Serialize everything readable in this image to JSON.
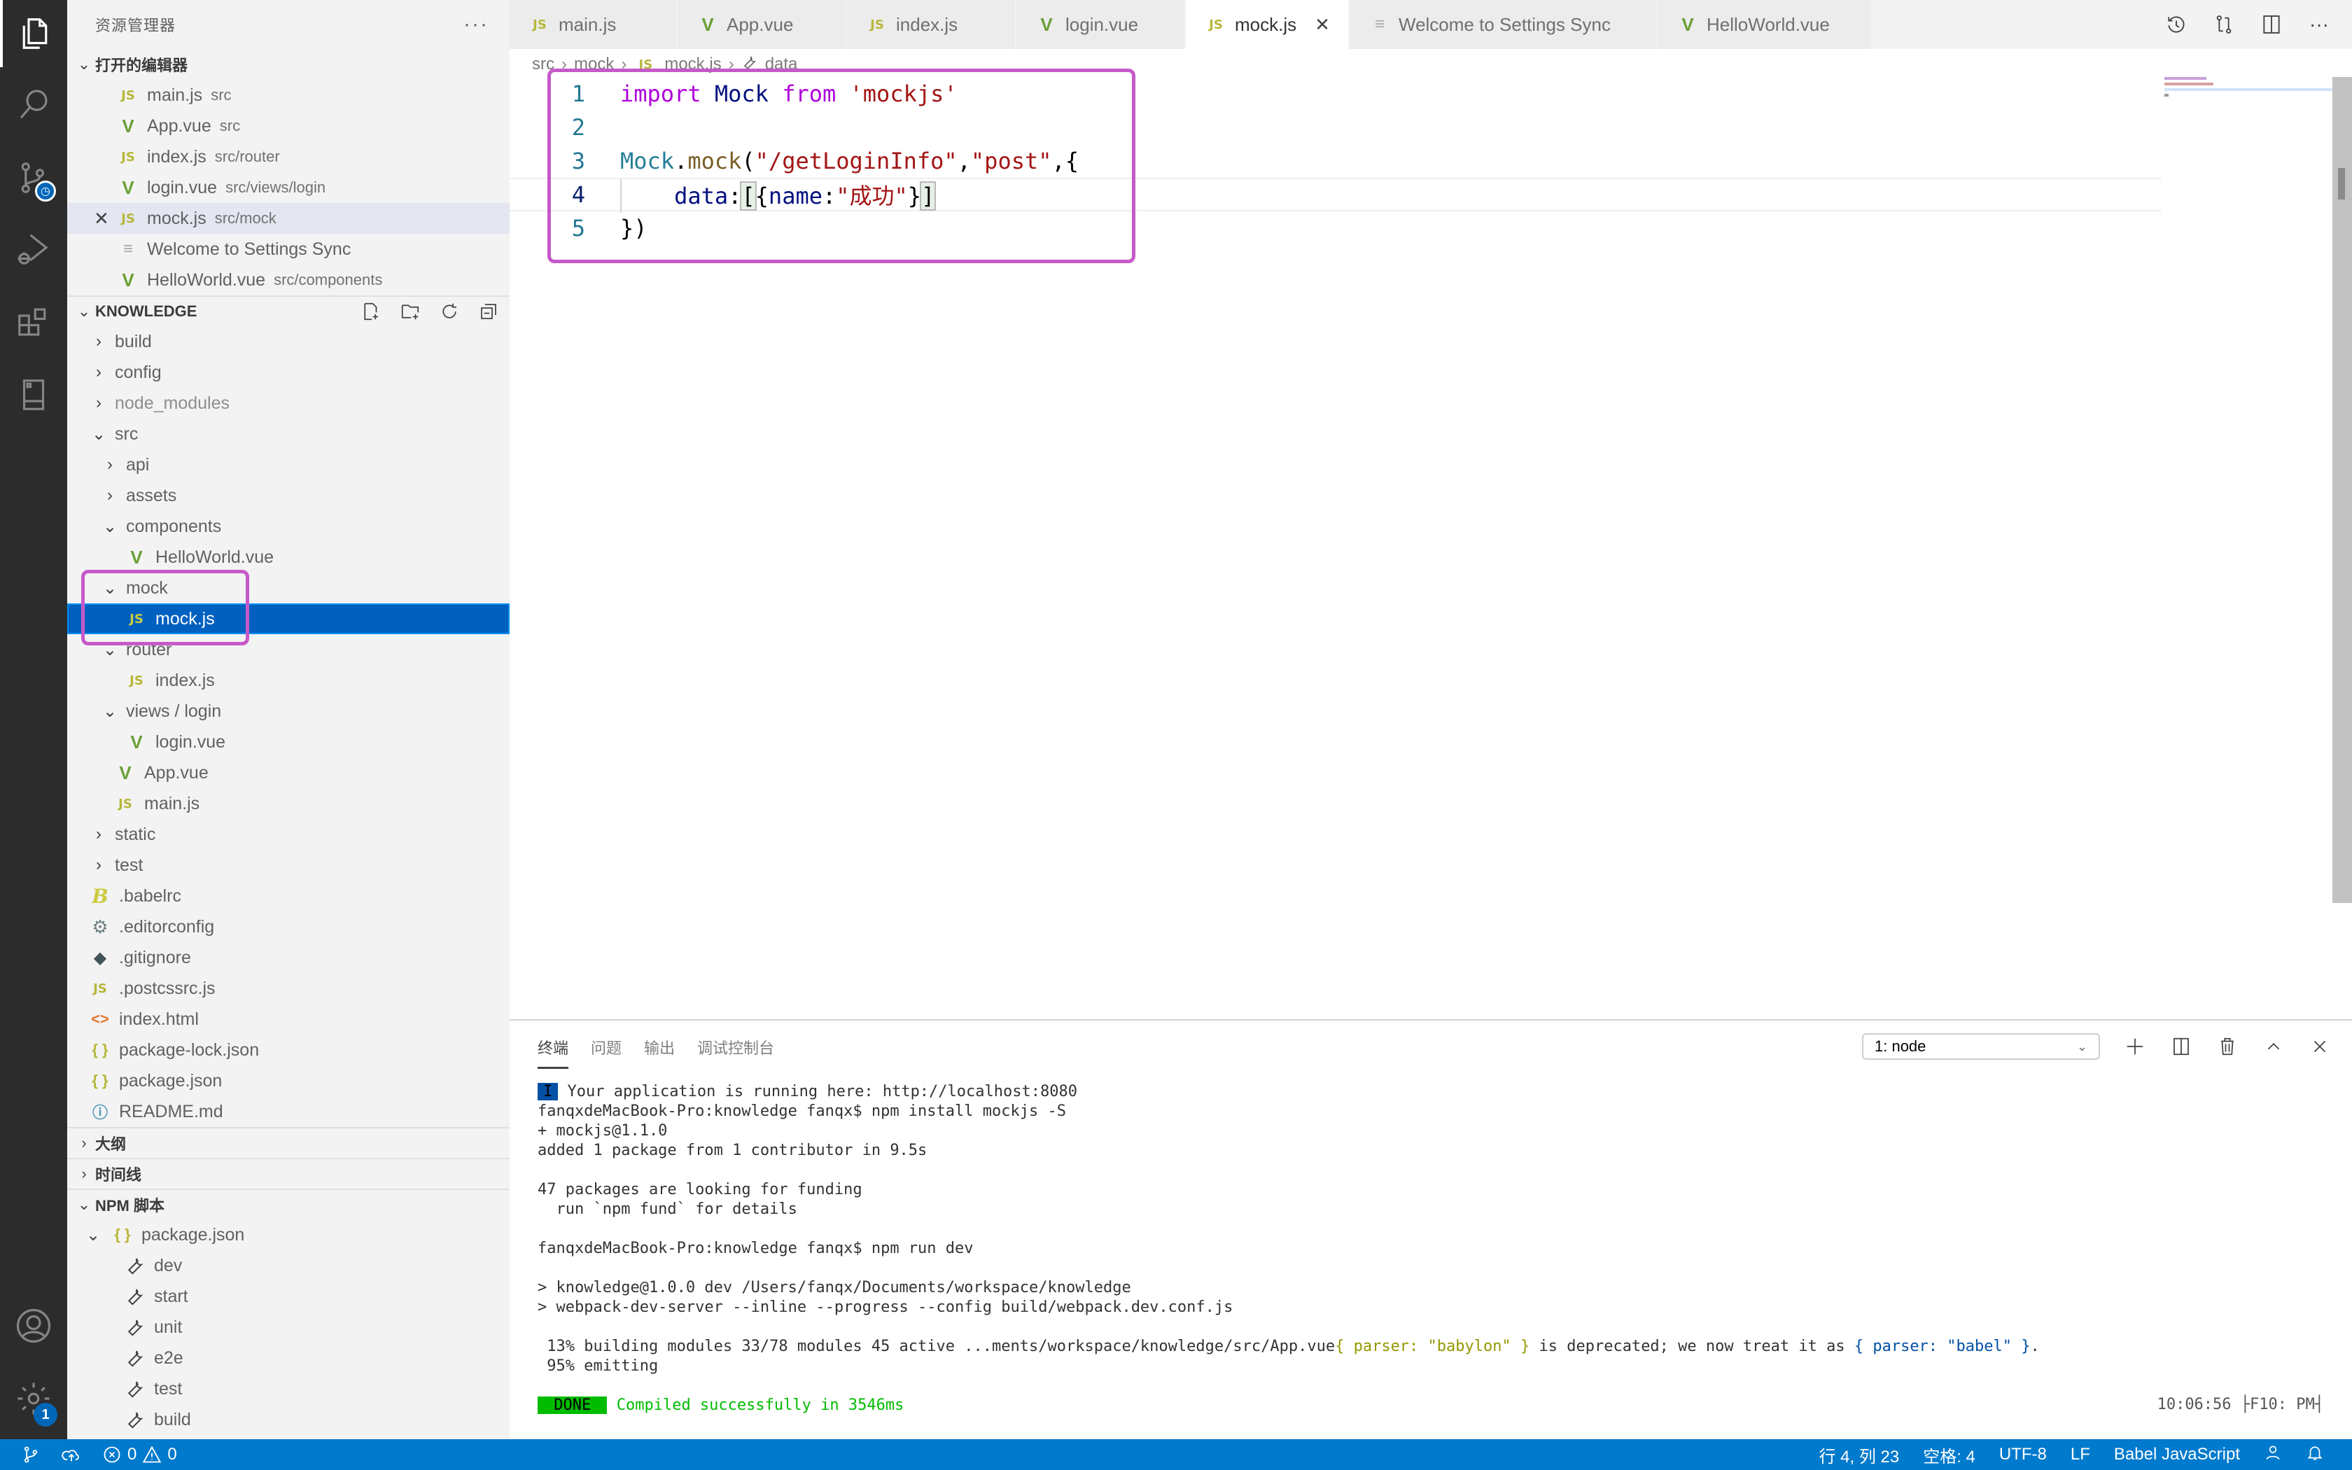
{
  "activity_bar": {
    "items": [
      {
        "name": "explorer",
        "icon": "files-icon",
        "active": true
      },
      {
        "name": "search",
        "icon": "search-icon"
      },
      {
        "name": "source-control",
        "icon": "source-control-icon"
      },
      {
        "name": "run-debug",
        "icon": "run-debug-icon"
      },
      {
        "name": "extensions",
        "icon": "extensions-icon"
      },
      {
        "name": "remote-explorer",
        "icon": "remote-icon"
      }
    ],
    "bottom": [
      {
        "name": "accounts",
        "icon": "account-icon"
      },
      {
        "name": "manage",
        "icon": "gear-icon",
        "badge": "1"
      }
    ]
  },
  "sidebar": {
    "title": "资源管理器",
    "more": "···",
    "open_editors": {
      "title": "打开的编辑器",
      "items": [
        {
          "icon": "js",
          "name": "main.js",
          "desc": "src"
        },
        {
          "icon": "vue",
          "name": "App.vue",
          "desc": "src"
        },
        {
          "icon": "js",
          "name": "index.js",
          "desc": "src/router"
        },
        {
          "icon": "vue",
          "name": "login.vue",
          "desc": "src/views/login"
        },
        {
          "icon": "js",
          "name": "mock.js",
          "desc": "src/mock",
          "active": true
        },
        {
          "icon": "txt",
          "name": "Welcome to Settings Sync",
          "desc": ""
        },
        {
          "icon": "vue",
          "name": "HelloWorld.vue",
          "desc": "src/components"
        }
      ]
    },
    "folder": {
      "title": "KNOWLEDGE",
      "tree": [
        {
          "label": "build",
          "type": "folder",
          "expanded": false,
          "depth": 0
        },
        {
          "label": "config",
          "type": "folder",
          "expanded": false,
          "depth": 0
        },
        {
          "label": "node_modules",
          "type": "folder",
          "expanded": false,
          "depth": 0,
          "dim": true
        },
        {
          "label": "src",
          "type": "folder",
          "expanded": true,
          "depth": 0
        },
        {
          "label": "api",
          "type": "folder",
          "expanded": false,
          "depth": 1
        },
        {
          "label": "assets",
          "type": "folder",
          "expanded": false,
          "depth": 1
        },
        {
          "label": "components",
          "type": "folder",
          "expanded": true,
          "depth": 1
        },
        {
          "label": "HelloWorld.vue",
          "type": "vue",
          "depth": 2
        },
        {
          "label": "mock",
          "type": "folder",
          "expanded": true,
          "depth": 1
        },
        {
          "label": "mock.js",
          "type": "js",
          "depth": 2,
          "selected": true
        },
        {
          "label": "router",
          "type": "folder",
          "expanded": true,
          "depth": 1
        },
        {
          "label": "index.js",
          "type": "js",
          "depth": 2
        },
        {
          "label": "views / login",
          "type": "folder",
          "expanded": true,
          "depth": 1
        },
        {
          "label": "login.vue",
          "type": "vue",
          "depth": 2
        },
        {
          "label": "App.vue",
          "type": "vue",
          "depth": 1
        },
        {
          "label": "main.js",
          "type": "js",
          "depth": 1
        },
        {
          "label": "static",
          "type": "folder",
          "expanded": false,
          "depth": 0
        },
        {
          "label": "test",
          "type": "folder",
          "expanded": false,
          "depth": 0
        },
        {
          "label": ".babelrc",
          "type": "babel",
          "depth": 0
        },
        {
          "label": ".editorconfig",
          "type": "gear",
          "depth": 0
        },
        {
          "label": ".gitignore",
          "type": "git",
          "depth": 0
        },
        {
          "label": ".postcssrc.js",
          "type": "js",
          "depth": 0
        },
        {
          "label": "index.html",
          "type": "html",
          "depth": 0
        },
        {
          "label": "package-lock.json",
          "type": "json",
          "depth": 0
        },
        {
          "label": "package.json",
          "type": "json",
          "depth": 0
        },
        {
          "label": "README.md",
          "type": "info",
          "depth": 0
        }
      ]
    },
    "outline": {
      "title": "大纲"
    },
    "timeline": {
      "title": "时间线"
    },
    "npm_scripts": {
      "title": "NPM 脚本",
      "package": "package.json",
      "scripts": [
        "dev",
        "start",
        "unit",
        "e2e",
        "test",
        "build"
      ]
    }
  },
  "tabs": [
    {
      "icon": "js",
      "label": "main.js"
    },
    {
      "icon": "vue",
      "label": "App.vue"
    },
    {
      "icon": "js",
      "label": "index.js"
    },
    {
      "icon": "vue",
      "label": "login.vue"
    },
    {
      "icon": "js",
      "label": "mock.js",
      "active": true
    },
    {
      "icon": "txt",
      "label": "Welcome to Settings Sync"
    },
    {
      "icon": "vue",
      "label": "HelloWorld.vue"
    }
  ],
  "breadcrumb": [
    "src",
    "mock",
    "mock.js",
    "data"
  ],
  "code": {
    "lines": [
      {
        "n": "1",
        "tokens": [
          {
            "t": "import",
            "c": "kw"
          },
          {
            "t": " ",
            "c": ""
          },
          {
            "t": "Mock",
            "c": "id"
          },
          {
            "t": " ",
            "c": ""
          },
          {
            "t": "from",
            "c": "kw"
          },
          {
            "t": " ",
            "c": ""
          },
          {
            "t": "'mockjs'",
            "c": "str"
          }
        ]
      },
      {
        "n": "2",
        "tokens": []
      },
      {
        "n": "3",
        "tokens": [
          {
            "t": "Mock",
            "c": "cls"
          },
          {
            "t": ".",
            "c": "pun"
          },
          {
            "t": "mock",
            "c": "fn"
          },
          {
            "t": "(",
            "c": "pun"
          },
          {
            "t": "\"/getLoginInfo\"",
            "c": "str"
          },
          {
            "t": ",",
            "c": "pun"
          },
          {
            "t": "\"post\"",
            "c": "str"
          },
          {
            "t": ",{",
            "c": "pun"
          }
        ]
      },
      {
        "n": "4",
        "current": true,
        "tokens": [
          {
            "t": "    ",
            "c": ""
          },
          {
            "t": "data",
            "c": "id"
          },
          {
            "t": ":",
            "c": "pun"
          },
          {
            "t": "[",
            "c": "pun bm"
          },
          {
            "t": "{",
            "c": "pun"
          },
          {
            "t": "name",
            "c": "id"
          },
          {
            "t": ":",
            "c": "pun"
          },
          {
            "t": "\"成功\"",
            "c": "str"
          },
          {
            "t": "}",
            "c": "pun"
          },
          {
            "t": "]",
            "c": "pun bm"
          }
        ]
      },
      {
        "n": "5",
        "tokens": [
          {
            "t": "})",
            "c": "pun"
          }
        ]
      }
    ]
  },
  "panel": {
    "tabs": [
      "终端",
      "问题",
      "输出",
      "调试控制台"
    ],
    "active_tab": 0,
    "terminal_select": "1: node",
    "terminal_lines": [
      [
        {
          "t": "I",
          "c": "cursor-blk"
        },
        {
          "t": " Your application is running here: http://localhost:8080",
          "c": ""
        }
      ],
      [
        {
          "t": "fanqxdeMacBook-Pro:knowledge fanqx$ npm install mockjs -S",
          "c": ""
        }
      ],
      [
        {
          "t": "+ mockjs@1.1.0",
          "c": ""
        }
      ],
      [
        {
          "t": "added 1 package from 1 contributor in 9.5s",
          "c": ""
        }
      ],
      [],
      [
        {
          "t": "47 packages are looking for funding",
          "c": ""
        }
      ],
      [
        {
          "t": "  run `npm fund` for details",
          "c": ""
        }
      ],
      [],
      [
        {
          "t": "fanqxdeMacBook-Pro:knowledge fanqx$ npm run dev",
          "c": ""
        }
      ],
      [],
      [
        {
          "t": "> knowledge@1.0.0 dev /Users/fanqx/Documents/workspace/knowledge",
          "c": ""
        }
      ],
      [
        {
          "t": "> webpack-dev-server --inline --progress --config build/webpack.dev.conf.js",
          "c": ""
        }
      ],
      [],
      [
        {
          "t": " 13% building modules 33/78 modules 45 active ...ments/workspace/knowledge/src/App.vue",
          "c": ""
        },
        {
          "t": "{ parser: \"babylon\" }",
          "c": "y"
        },
        {
          "t": " is deprecated; we now treat it as ",
          "c": ""
        },
        {
          "t": "{ parser: \"babel\" }",
          "c": "b"
        },
        {
          "t": ".",
          "c": ""
        }
      ],
      [
        {
          "t": " 95% emitting",
          "c": ""
        }
      ],
      [],
      [
        {
          "t": " DONE ",
          "c": "done"
        },
        {
          "t": " Compiled successfully in 3546ms",
          "c": "g"
        }
      ]
    ],
    "terminal_time": "10:06:56 ├F10: PM┤"
  },
  "statusbar": {
    "errors": "0",
    "warnings": "0",
    "position": "行 4, 列 23",
    "indent": "空格: 4",
    "encoding": "UTF-8",
    "eol": "LF",
    "language": "Babel JavaScript"
  },
  "colors": {
    "accent": "#007acc",
    "selection": "#0060c0",
    "annotation": "#c659c9"
  }
}
